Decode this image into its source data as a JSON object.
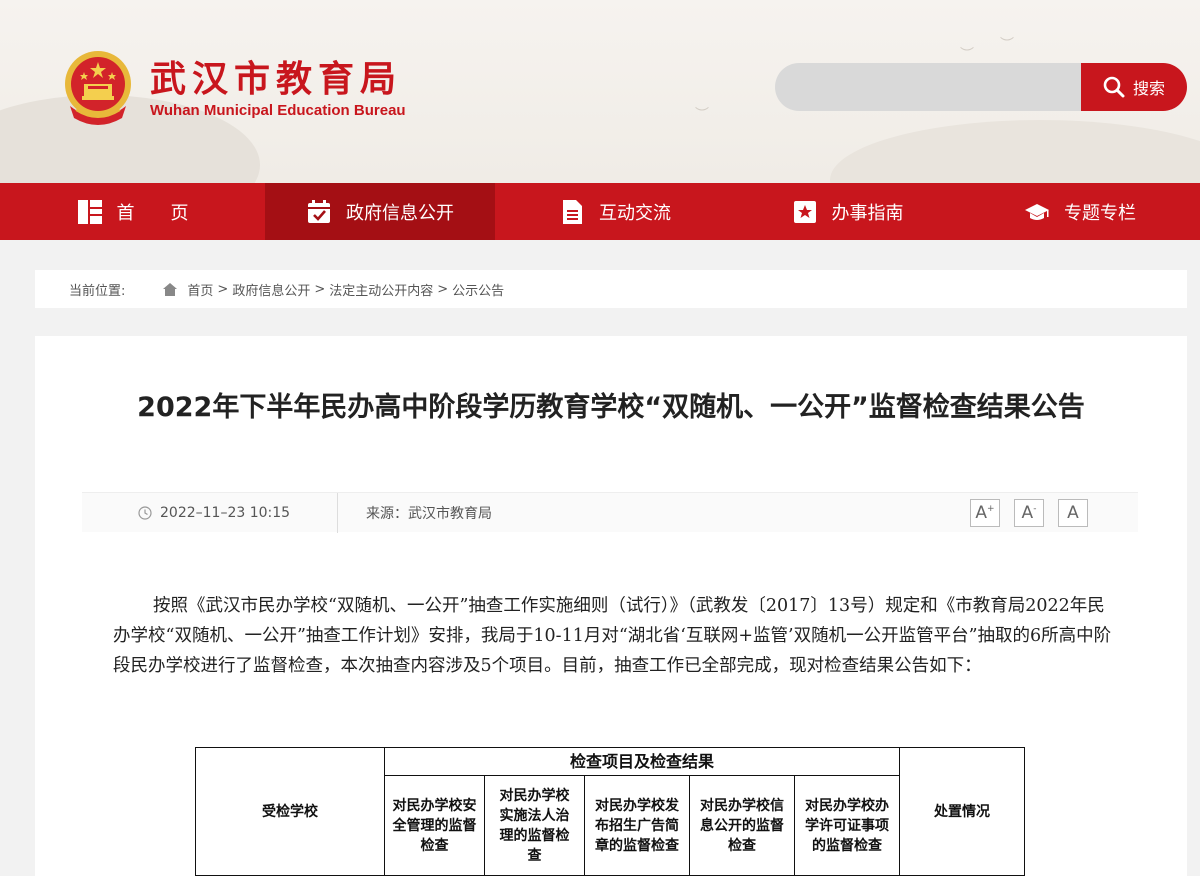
{
  "header": {
    "title_cn": "武汉市教育局",
    "title_en": "Wuhan Municipal Education Bureau",
    "search_placeholder": "",
    "search_label": "搜索",
    "icons": {
      "emblem": "national-emblem-icon",
      "search": "search-icon"
    }
  },
  "nav": {
    "items": [
      {
        "label": "首　　页",
        "icon": "home-grid-icon"
      },
      {
        "label": "政府信息公开",
        "icon": "calendar-check-icon"
      },
      {
        "label": "互动交流",
        "icon": "document-icon"
      },
      {
        "label": "办事指南",
        "icon": "star-bookmark-icon"
      },
      {
        "label": "专题专栏",
        "icon": "graduation-cap-icon"
      }
    ],
    "active_index": 1
  },
  "breadcrumb": {
    "prefix": "当前位置:",
    "items": [
      "首页",
      "政府信息公开",
      "法定主动公开内容",
      "公示公告"
    ],
    "separator": ">"
  },
  "article": {
    "title": "2022年下半年民办高中阶段学历教育学校“双随机、一公开”监督检查结果公告",
    "date": "2022–11–23 10:15",
    "source": "来源：武汉市教育局",
    "font_buttons": [
      "A",
      "A",
      "A"
    ],
    "font_button_marks": [
      "+",
      "-",
      ""
    ],
    "paragraph": "按照《武汉市民办学校“双随机、一公开”抽查工作实施细则（试行）》（武教发〔2017〕13号）规定和《市教育局2022年民办学校“双随机、一公开”抽查工作计划》安排，我局于10-11月对“湖北省‘互联网+监管’双随机一公开监管平台”抽取的6所高中阶段民办学校进行了监督检查，本次抽查内容涉及5个项目。目前，抽查工作已全部完成，现对检查结果公告如下："
  },
  "table": {
    "school_header": "受检学校",
    "group_header": "检查项目及检查结果",
    "items": [
      "对民办学校安全管理的监督检查",
      "对民办学校实施法人治理的监督检查",
      "对民办学校发布招生广告简章的监督检查",
      "对民办学校信息公开的监督检查",
      "对民办学校办学许可证事项的监督检查"
    ],
    "result_header": "处置情况"
  },
  "colors": {
    "brand_red": "#c8161d",
    "nav_active": "#a40f14"
  }
}
